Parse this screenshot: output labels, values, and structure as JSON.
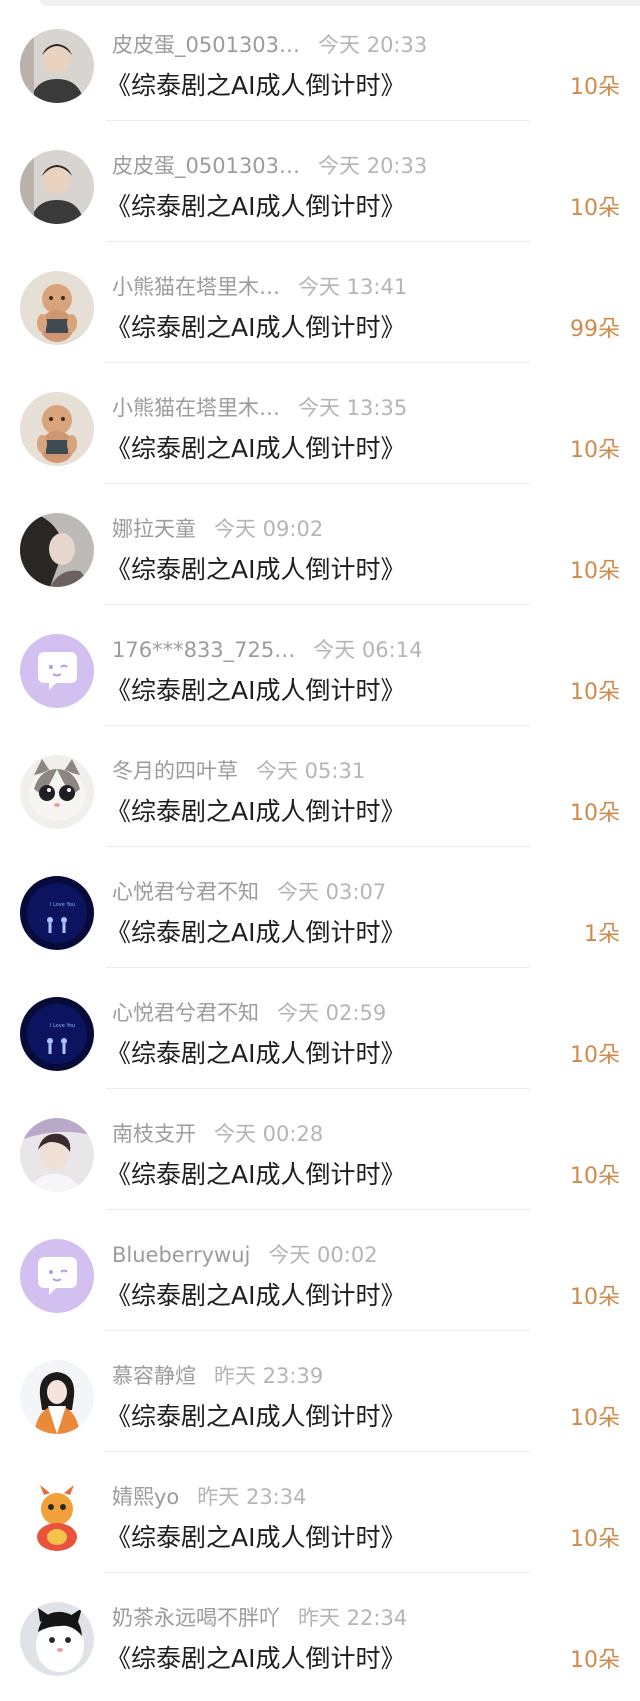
{
  "items": [
    {
      "user": "皮皮蛋_0501303…",
      "time": "今天 20:33",
      "title": "《综泰剧之AI成人倒计时》",
      "gift": "10朵",
      "avatar": "avatar-boy-icon"
    },
    {
      "user": "皮皮蛋_0501303…",
      "time": "今天 20:33",
      "title": "《综泰剧之AI成人倒计时》",
      "gift": "10朵",
      "avatar": "avatar-boy-icon"
    },
    {
      "user": "小熊猫在塔里木…",
      "time": "今天 13:41",
      "title": "《综泰剧之AI成人倒计时》",
      "gift": "99朵",
      "avatar": "avatar-baby-icon"
    },
    {
      "user": "小熊猫在塔里木…",
      "time": "今天 13:35",
      "title": "《综泰剧之AI成人倒计时》",
      "gift": "10朵",
      "avatar": "avatar-baby-icon"
    },
    {
      "user": "娜拉天童",
      "time": "今天 09:02",
      "title": "《综泰剧之AI成人倒计时》",
      "gift": "10朵",
      "avatar": "avatar-portrait-icon"
    },
    {
      "user": "176***833_725…",
      "time": "今天 06:14",
      "title": "《综泰剧之AI成人倒计时》",
      "gift": "10朵",
      "avatar": "default-chat-avatar-icon"
    },
    {
      "user": "冬月的四叶草",
      "time": "今天 05:31",
      "title": "《综泰剧之AI成人倒计时》",
      "gift": "10朵",
      "avatar": "avatar-cat-icon"
    },
    {
      "user": "心悦君兮君不知",
      "time": "今天 03:07",
      "title": "《综泰剧之AI成人倒计时》",
      "gift": "1朵",
      "avatar": "avatar-night-couple-icon"
    },
    {
      "user": "心悦君兮君不知",
      "time": "今天 02:59",
      "title": "《综泰剧之AI成人倒计时》",
      "gift": "10朵",
      "avatar": "avatar-night-couple-icon"
    },
    {
      "user": "南枝支开",
      "time": "今天 00:28",
      "title": "《综泰剧之AI成人倒计时》",
      "gift": "10朵",
      "avatar": "avatar-man-icon"
    },
    {
      "user": "Blueberrywuj",
      "time": "今天 00:02",
      "title": "《综泰剧之AI成人倒计时》",
      "gift": "10朵",
      "avatar": "default-chat-avatar-icon"
    },
    {
      "user": "慕容静煊",
      "time": "昨天 23:39",
      "title": "《综泰剧之AI成人倒计时》",
      "gift": "10朵",
      "avatar": "avatar-girl-snow-icon"
    },
    {
      "user": "婧熙yo",
      "time": "昨天 23:34",
      "title": "《综泰剧之AI成人倒计时》",
      "gift": "10朵",
      "avatar": "avatar-dragon-icon"
    },
    {
      "user": "奶茶永远喝不胖吖",
      "time": "昨天 22:34",
      "title": "《综泰剧之AI成人倒计时》",
      "gift": "10朵",
      "avatar": "avatar-cat-bw-icon"
    }
  ]
}
